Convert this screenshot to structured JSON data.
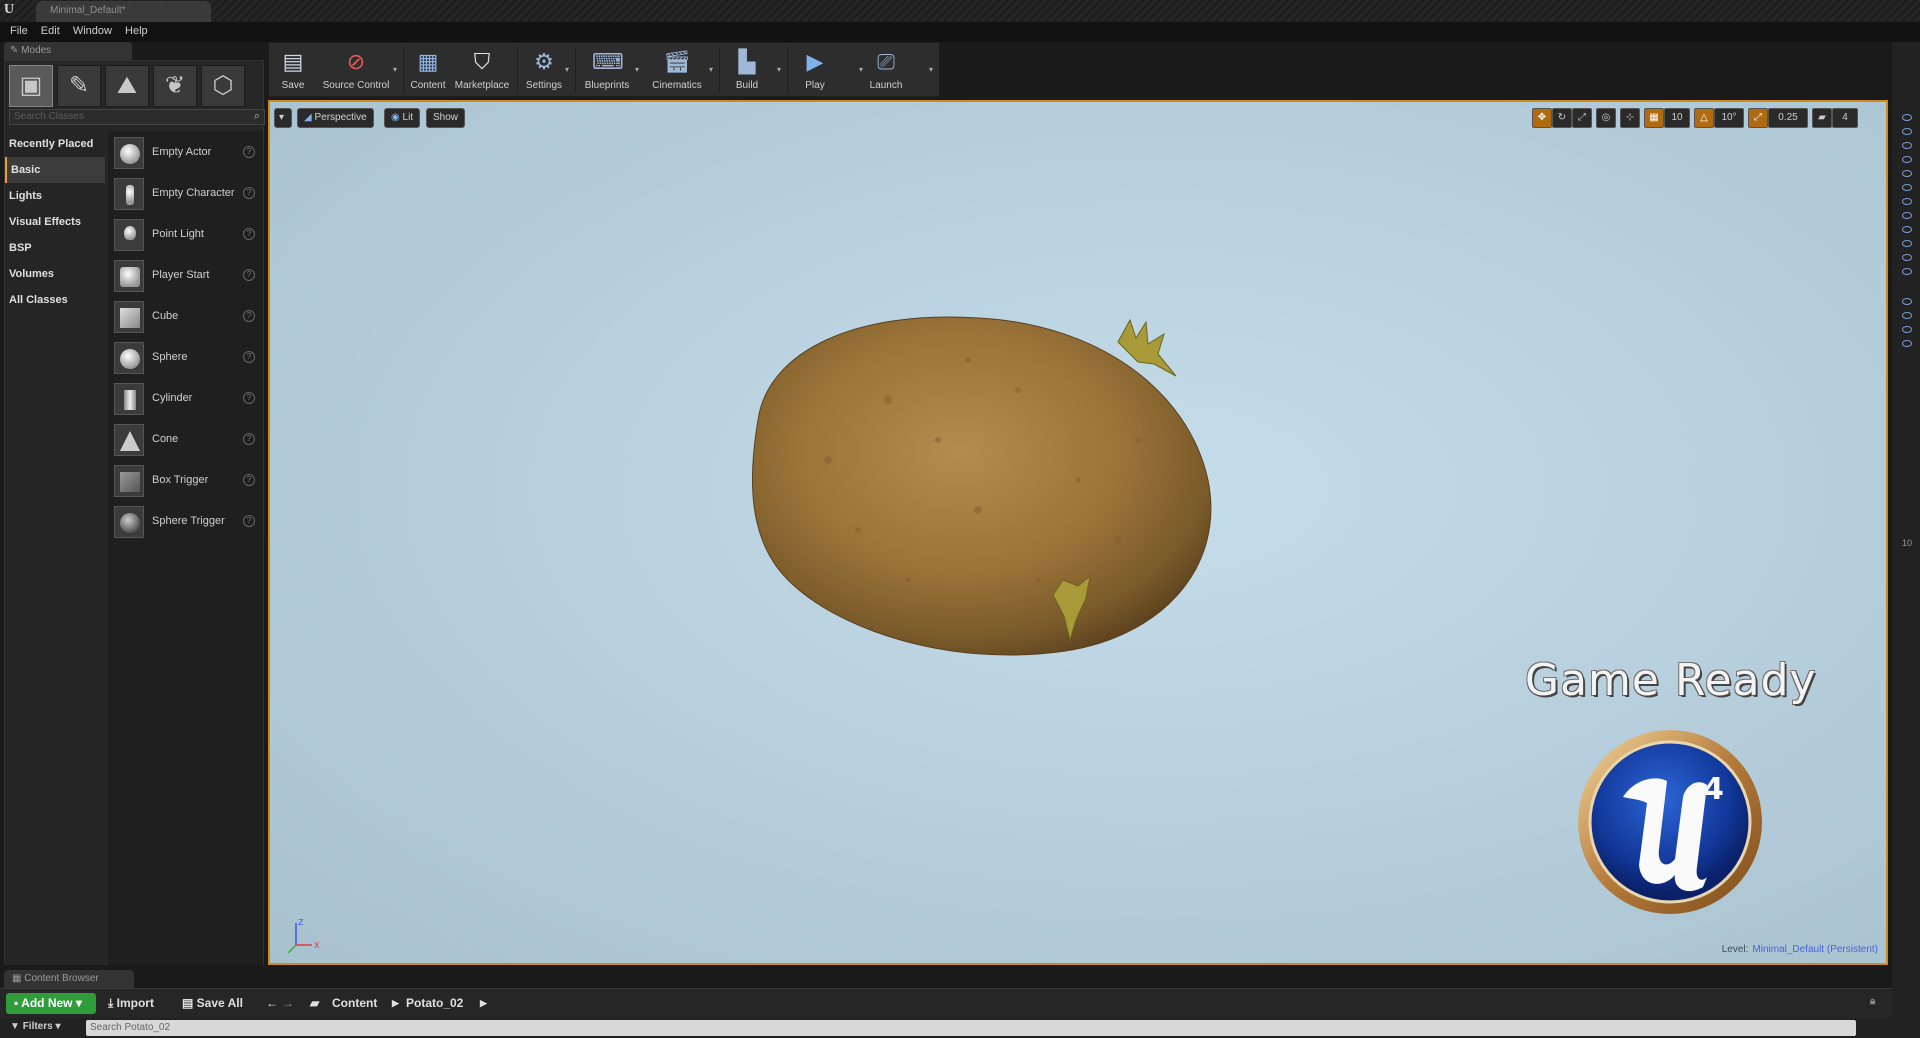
{
  "window": {
    "doc_tab": "Minimal_Default*"
  },
  "menu": [
    "File",
    "Edit",
    "Window",
    "Help"
  ],
  "modes": {
    "tab_label": "Modes",
    "search_placeholder": "Search Classes",
    "categories": [
      "Recently Placed",
      "Basic",
      "Lights",
      "Visual Effects",
      "BSP",
      "Volumes",
      "All Classes"
    ],
    "active_category": "Basic",
    "classes": [
      "Empty Actor",
      "Empty Character",
      "Point Light",
      "Player Start",
      "Cube",
      "Sphere",
      "Cylinder",
      "Cone",
      "Box Trigger",
      "Sphere Trigger"
    ]
  },
  "toolbar": {
    "buttons": [
      "Save",
      "Source Control",
      "Content",
      "Marketplace",
      "Settings",
      "Blueprints",
      "Cinematics",
      "Build",
      "Play",
      "Launch"
    ]
  },
  "viewport": {
    "perspective": "Perspective",
    "lit": "Lit",
    "show": "Show",
    "grid_snap": "10",
    "rotation_snap": "10°",
    "scale_snap": "0.25",
    "camera_speed": "4",
    "overlay_text": "Game Ready",
    "level_label": "Level:",
    "level_name": "Minimal_Default (Persistent)",
    "badge_text": "4"
  },
  "right_panel": {
    "clipped_number": "10"
  },
  "content_browser": {
    "tab_label": "Content Browser",
    "add_new": "Add New",
    "import": "Import",
    "save_all": "Save All",
    "breadcrumb": [
      "Content",
      "Potato_02"
    ],
    "filters": "Filters",
    "search_placeholder": "Search Potato_02"
  },
  "colors": {
    "accent_orange": "#d08a1c",
    "add_new_green": "#2f9d3a",
    "viewport_sky": "#b6cedc"
  }
}
